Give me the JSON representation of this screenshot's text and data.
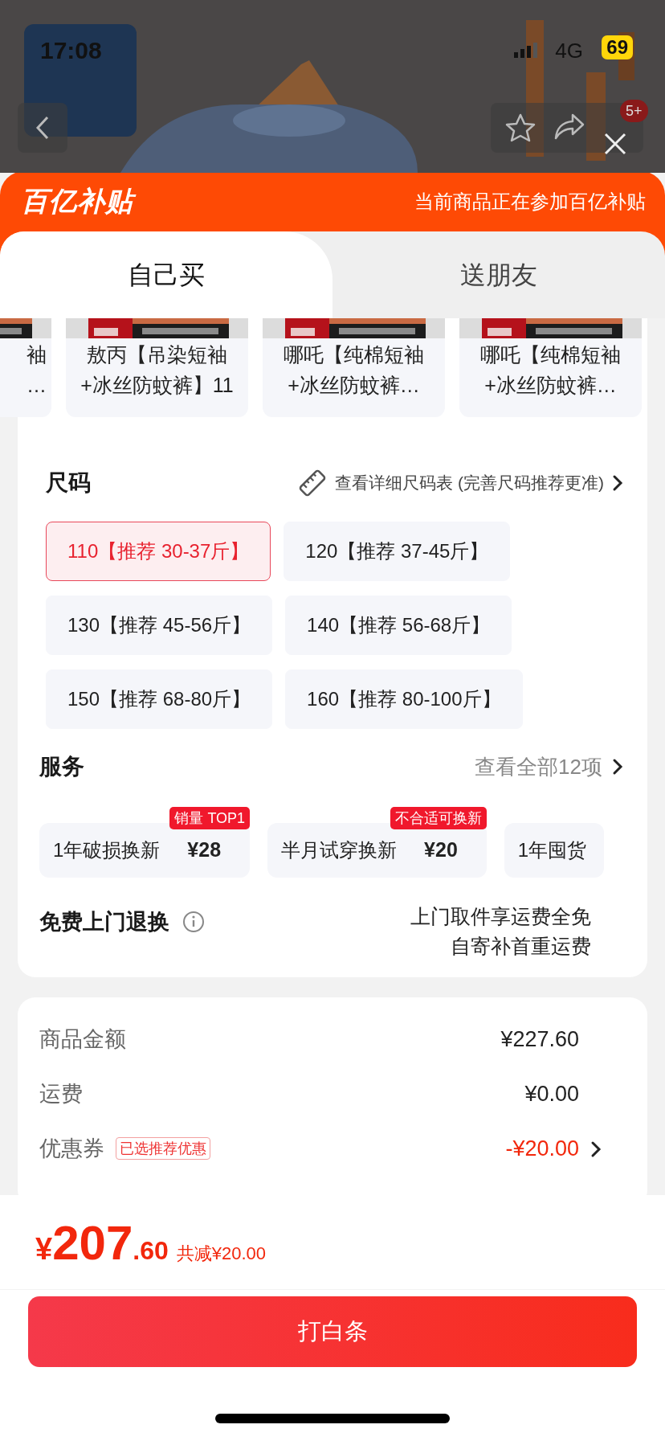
{
  "status_bar": {
    "time": "17:08",
    "network": "4G",
    "battery": "69"
  },
  "header": {
    "badge": "5+"
  },
  "banner": {
    "logo": "百亿补贴",
    "notice": "当前商品正在参加百亿补贴"
  },
  "tabs": [
    {
      "label": "自己买",
      "selected": true
    },
    {
      "label": "送朋友",
      "selected": false
    }
  ],
  "products": [
    {
      "lines": [
        "袖",
        "…"
      ],
      "kind": "partial"
    },
    {
      "lines": [
        "敖丙【吊染短袖",
        "+冰丝防蚊裤】11"
      ],
      "kind": "full"
    },
    {
      "lines": [
        "哪吒【纯棉短袖",
        "+冰丝防蚊裤…"
      ],
      "kind": "full"
    },
    {
      "lines": [
        "哪吒【纯棉短袖",
        "+冰丝防蚊裤…"
      ],
      "kind": "full"
    }
  ],
  "size": {
    "title": "尺码",
    "guide": "查看详细尺码表 (完善尺码推荐更准)",
    "options": [
      {
        "label": "110【推荐 30-37斤】",
        "selected": true
      },
      {
        "label": "120【推荐 37-45斤】",
        "selected": false
      },
      {
        "label": "130【推荐 45-56斤】",
        "selected": false
      },
      {
        "label": "140【推荐 56-68斤】",
        "selected": false
      },
      {
        "label": "150【推荐 68-80斤】",
        "selected": false
      },
      {
        "label": "160【推荐 80-100斤】",
        "selected": false
      }
    ]
  },
  "services": {
    "title": "服务",
    "more": "查看全部12项",
    "items": [
      {
        "name": "1年破损换新",
        "price": "¥28",
        "tag": "销量 TOP1"
      },
      {
        "name": "半月试穿换新",
        "price": "¥20",
        "tag": "不合适可换新"
      },
      {
        "name": "1年囤货"
      }
    ]
  },
  "free_return": {
    "title": "免费上门退换",
    "lines": [
      "上门取件享运费全免",
      "自寄补首重运费"
    ]
  },
  "summary": [
    {
      "label": "商品金额",
      "value": "¥227.60",
      "kind": "plain"
    },
    {
      "label": "运费",
      "value": "¥0.00",
      "kind": "plain"
    },
    {
      "label": "优惠券",
      "tag": "已选推荐优惠",
      "value": "-¥20.00",
      "kind": "discount"
    }
  ],
  "total": {
    "currency": "¥",
    "integer": "207",
    "decimal": ".60",
    "saving": "共减¥20.00"
  },
  "pay_button": "打白条"
}
